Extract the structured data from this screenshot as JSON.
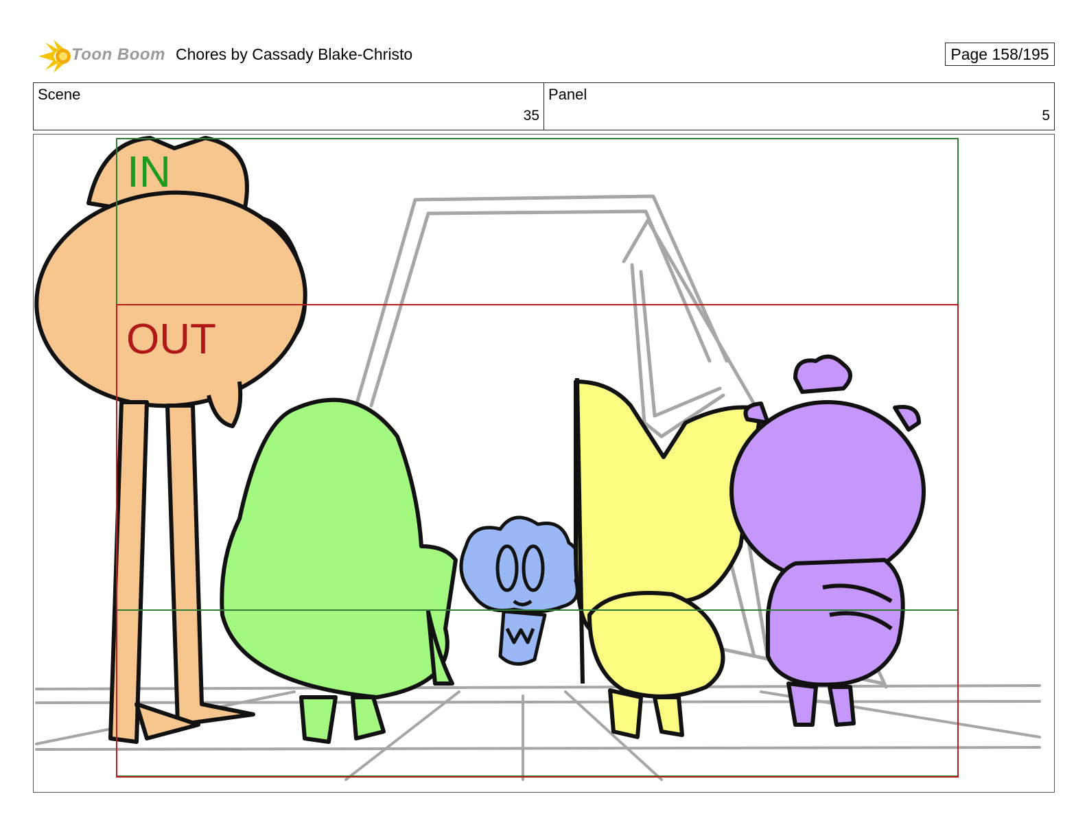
{
  "header": {
    "logo_text": "Toon Boom",
    "title": "Chores  by Cassady Blake-Christo",
    "page_label": "Page 158/195"
  },
  "meta": {
    "scene_label": "Scene",
    "scene_value": "35",
    "panel_label": "Panel",
    "panel_value": "5"
  },
  "panel": {
    "in_label": "IN",
    "out_label": "OUT",
    "colors": {
      "in_frame": "#2e7d32",
      "out_frame": "#b71c1c",
      "orange_character": "#f7c58e",
      "green_character": "#a3f97f",
      "blue_character": "#9ab8f5",
      "yellow_character": "#fbfb82",
      "purple_character": "#c597fb",
      "sketch_lines": "#a6a6a6"
    }
  }
}
